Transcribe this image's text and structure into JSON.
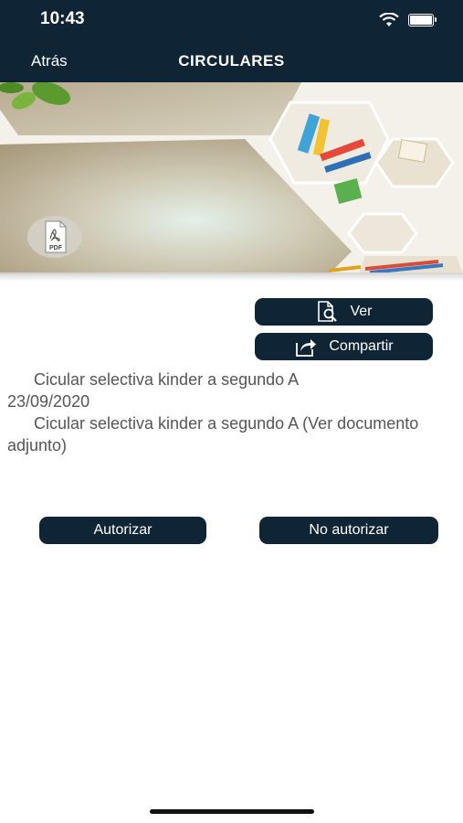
{
  "status_bar": {
    "time": "10:43"
  },
  "nav": {
    "back_label": "Atrás",
    "title": "CIRCULARES"
  },
  "banner": {
    "pdf_label": "PDF"
  },
  "actions": {
    "ver_label": "Ver",
    "compartir_label": "Compartir"
  },
  "circular": {
    "title": "Cicular selectiva kinder a segundo A",
    "date": "23/09/2020",
    "description": "Cicular selectiva kinder a segundo A (Ver documento adjunto)"
  },
  "authorization": {
    "autorizar_label": "Autorizar",
    "no_autorizar_label": "No autorizar"
  },
  "colors": {
    "nav_background": "#0f2434",
    "button_background": "#0f2434",
    "body_text": "#555555"
  }
}
